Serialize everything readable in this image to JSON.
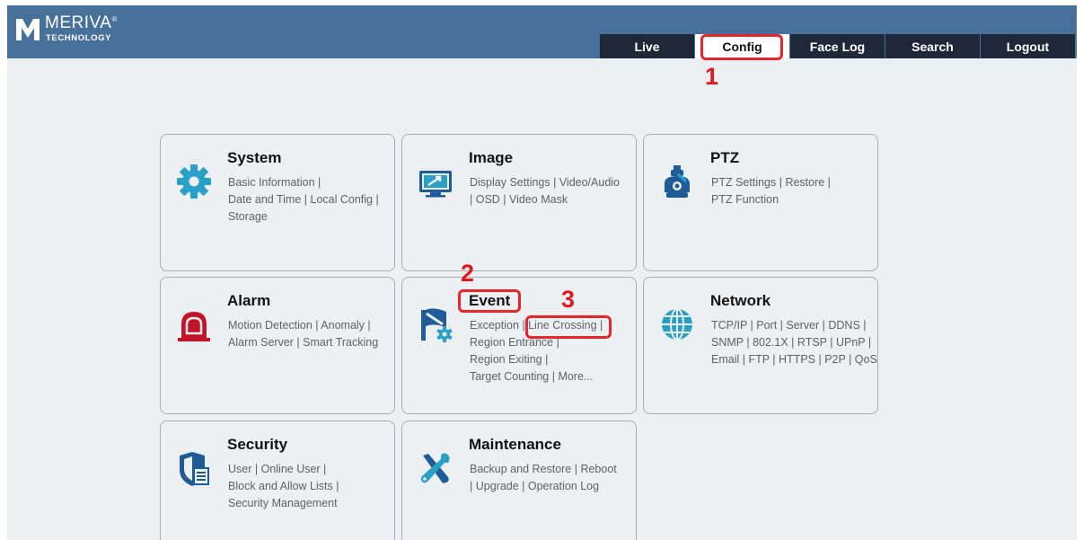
{
  "header": {
    "brand_name": "MERIVA",
    "brand_mark": "®",
    "brand_sub": "TECHNOLOGY",
    "tabs": [
      {
        "label": "Live",
        "active": false
      },
      {
        "label": "Config",
        "active": true
      },
      {
        "label": "Face Log",
        "active": false
      },
      {
        "label": "Search",
        "active": false
      },
      {
        "label": "Logout",
        "active": false
      }
    ]
  },
  "annotations": {
    "step1": "1",
    "step2": "2",
    "step3": "3",
    "highlight_color": "#e8252a"
  },
  "cards": {
    "system": {
      "title": "System",
      "icon": "gear-icon",
      "lines": [
        "Basic Information |",
        "Date and Time | Local Config |",
        "Storage"
      ]
    },
    "image": {
      "title": "Image",
      "icon": "monitor-icon",
      "lines": [
        "Display Settings | Video/Audio",
        " | OSD | Video Mask"
      ]
    },
    "ptz": {
      "title": "PTZ",
      "icon": "ptz-camera-icon",
      "lines": [
        "PTZ Settings | Restore |",
        "PTZ Function"
      ]
    },
    "alarm": {
      "title": "Alarm",
      "icon": "alarm-light-icon",
      "lines": [
        "Motion Detection | Anomaly |",
        "Alarm Server | Smart Tracking"
      ]
    },
    "event": {
      "title": "Event",
      "icon": "event-flag-icon",
      "lines": [
        "Exception | Line Crossing |",
        "Region Entrance |",
        "Region Exiting |",
        "Target Counting | More..."
      ]
    },
    "network": {
      "title": "Network",
      "icon": "globe-icon",
      "lines": [
        "TCP/IP | Port | Server | DDNS |",
        "SNMP | 802.1X | RTSP | UPnP |",
        "Email | FTP | HTTPS | P2P | QoS"
      ]
    },
    "security": {
      "title": "Security",
      "icon": "shield-icon",
      "lines": [
        "User | Online User |",
        "Block and Allow Lists |",
        "Security Management"
      ]
    },
    "maintenance": {
      "title": "Maintenance",
      "icon": "tools-icon",
      "lines": [
        "Backup and Restore  | Reboot",
        " | Upgrade | Operation Log"
      ]
    }
  },
  "colors": {
    "header_bg": "#47709a",
    "tab_bg": "#1e2838",
    "icon_blue": "#1f5c97",
    "icon_teal": "#2aa0c7",
    "alarm_red": "#c4142b"
  }
}
